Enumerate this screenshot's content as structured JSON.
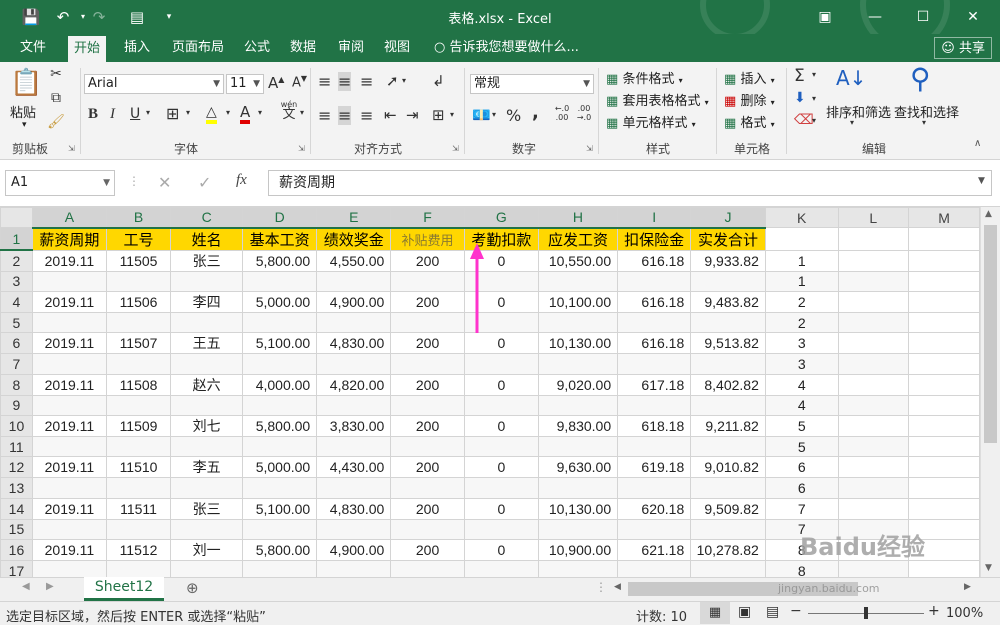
{
  "titlebar": {
    "title": "表格.xlsx - Excel",
    "bg": "#217346"
  },
  "tabs": [
    "文件",
    "开始",
    "插入",
    "页面布局",
    "公式",
    "数据",
    "审阅",
    "视图"
  ],
  "active_tab": "开始",
  "tellme": "告诉我您想要做什么...",
  "share": "共享",
  "ribbon": {
    "clipboard": {
      "paste": "粘贴",
      "label": "剪贴板"
    },
    "font": {
      "name": "Arial",
      "size": "11",
      "label": "字体",
      "wen": "wén",
      "wen2": "文"
    },
    "alignment": {
      "label": "对齐方式"
    },
    "number": {
      "format": "常规",
      "label": "数字",
      "pct": "%",
      "comma": ",",
      "dec_inc": "←.0\n.00",
      "dec_dec": ".00\n→.0"
    },
    "styles": {
      "cond": "条件格式",
      "table": "套用表格格式",
      "cell": "单元格样式",
      "label": "样式"
    },
    "cells": {
      "insert": "插入",
      "delete": "删除",
      "format": "格式",
      "label": "单元格"
    },
    "editing": {
      "sort": "排序和筛选",
      "find": "查找和选择",
      "label": "编辑"
    }
  },
  "formula_bar": {
    "namebox": "A1",
    "fx": "fx",
    "value": "薪资周期"
  },
  "columns": [
    "A",
    "B",
    "C",
    "D",
    "E",
    "F",
    "G",
    "H",
    "I",
    "J",
    "K",
    "L",
    "M"
  ],
  "rows": [
    "1",
    "2",
    "3",
    "4",
    "5",
    "6",
    "7",
    "8",
    "9",
    "10",
    "11",
    "12",
    "13",
    "14",
    "15",
    "16",
    "17"
  ],
  "table_header": [
    "薪资周期",
    "工号",
    "姓名",
    "基本工资",
    "绩效奖金",
    "补贴费用",
    "考勤扣款",
    "应发工资",
    "扣保险金",
    "实发合计"
  ],
  "records": [
    [
      "2019.11",
      "11505",
      "张三",
      "5,800.00",
      "4,550.00",
      "200",
      "0",
      "10,550.00",
      "616.18",
      "9,933.82"
    ],
    [
      "2019.11",
      "11506",
      "李四",
      "5,000.00",
      "4,900.00",
      "200",
      "0",
      "10,100.00",
      "616.18",
      "9,483.82"
    ],
    [
      "2019.11",
      "11507",
      "王五",
      "5,100.00",
      "4,830.00",
      "200",
      "0",
      "10,130.00",
      "616.18",
      "9,513.82"
    ],
    [
      "2019.11",
      "11508",
      "赵六",
      "4,000.00",
      "4,820.00",
      "200",
      "0",
      "9,020.00",
      "617.18",
      "8,402.82"
    ],
    [
      "2019.11",
      "11509",
      "刘七",
      "5,800.00",
      "3,830.00",
      "200",
      "0",
      "9,830.00",
      "618.18",
      "9,211.82"
    ],
    [
      "2019.11",
      "11510",
      "李五",
      "5,000.00",
      "4,430.00",
      "200",
      "0",
      "9,630.00",
      "619.18",
      "9,010.82"
    ],
    [
      "2019.11",
      "11511",
      "张三",
      "5,100.00",
      "4,830.00",
      "200",
      "0",
      "10,130.00",
      "620.18",
      "9,509.82"
    ],
    [
      "2019.11",
      "11512",
      "刘一",
      "5,800.00",
      "4,900.00",
      "200",
      "0",
      "10,900.00",
      "621.18",
      "10,278.82"
    ]
  ],
  "k_column": [
    "",
    "1",
    "1",
    "2",
    "2",
    "3",
    "3",
    "4",
    "4",
    "5",
    "5",
    "6",
    "6",
    "7",
    "7",
    "8",
    "8"
  ],
  "sheet": {
    "name": "Sheet12"
  },
  "status": {
    "message": "选定目标区域，然后按 ENTER 或选择“粘贴”",
    "count": "计数: 10",
    "zoom": "100%"
  },
  "watermark": {
    "site": "jingyan.baidu.com",
    "brand": "Baidu经验"
  },
  "colors": {
    "accent": "#217346",
    "header_fill": "#ffd700",
    "arrow": "#ff33cc"
  }
}
